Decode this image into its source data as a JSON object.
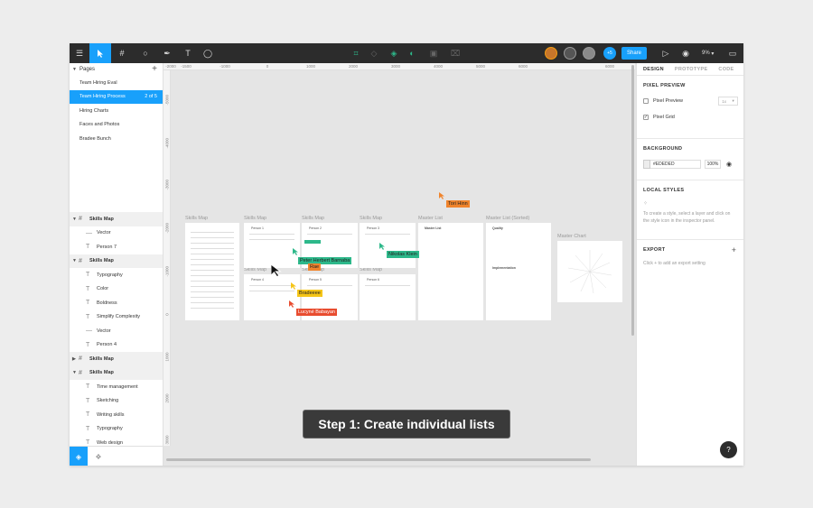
{
  "toolbar": {
    "share_label": "Share",
    "zoom_label": "9%",
    "avatar_count": "+5"
  },
  "pages": {
    "header": "Pages",
    "items": [
      {
        "label": "Team Hiring Eval"
      },
      {
        "label": "Team Hiring Process",
        "badge": "2 of 5"
      },
      {
        "label": "Hiring Charts"
      },
      {
        "label": "Faces and Photos"
      },
      {
        "label": "Bradee Bunch"
      }
    ]
  },
  "layers": [
    {
      "label": "Skills Map",
      "type": "frame"
    },
    {
      "label": "Vector",
      "type": "vector"
    },
    {
      "label": "Person 7",
      "type": "text"
    },
    {
      "label": "Skills Map",
      "type": "frame"
    },
    {
      "label": "Typography",
      "type": "text"
    },
    {
      "label": "Color",
      "type": "text"
    },
    {
      "label": "Boldness",
      "type": "text"
    },
    {
      "label": "Simplify Complexity",
      "type": "text"
    },
    {
      "label": "Vector",
      "type": "vector"
    },
    {
      "label": "Person 4",
      "type": "text"
    },
    {
      "label": "Skills Map",
      "type": "frame"
    },
    {
      "label": "Skills Map",
      "type": "frame"
    },
    {
      "label": "Time management",
      "type": "text"
    },
    {
      "label": "Sketching",
      "type": "text"
    },
    {
      "label": "Writing skills",
      "type": "text"
    },
    {
      "label": "Typography",
      "type": "text"
    },
    {
      "label": "Web design",
      "type": "text"
    }
  ],
  "ruler": {
    "top": [
      "-2000",
      "-1500",
      "-1000",
      "0",
      "1000",
      "2000",
      "3000",
      "4000",
      "5000",
      "6000",
      "6000"
    ],
    "left": [
      "-5000",
      "-4000",
      "-3000",
      "-2000",
      "-1000",
      "0",
      "1000",
      "2000",
      "3000"
    ]
  },
  "canvas": {
    "frames": [
      {
        "label": "Skills Map"
      },
      {
        "label": "Skills Map"
      },
      {
        "label": "Skills Map"
      },
      {
        "label": "Skills Map"
      },
      {
        "label": "Master List"
      },
      {
        "label": "Master List (Sorted)"
      },
      {
        "label": "Master Chart"
      },
      {
        "label": "Skills Map"
      },
      {
        "label": "Skills Map"
      },
      {
        "label": "Skills Map"
      }
    ],
    "artboard_text": {
      "person1": "Person 1",
      "person2": "Person 2",
      "person3": "Person 3",
      "person4": "Person 4",
      "person5": "Person 5",
      "person6": "Person 6",
      "master": "Master List",
      "sorted1": "Quality",
      "sorted2": "Implementation"
    },
    "cursors": [
      {
        "name": "Tori Hinn",
        "color": "#f0842c"
      },
      {
        "name": "Peter Herbert Barnaba",
        "color": "#2db88a"
      },
      {
        "name": "Rae",
        "color": "#f0842c"
      },
      {
        "name": "Nikolas Klein",
        "color": "#2db88a"
      },
      {
        "name": "Bradeeee",
        "color": "#f5c518"
      },
      {
        "name": "Lucyné Babayan",
        "color": "#e84c2f"
      }
    ]
  },
  "banner": "Step 1: Create individual lists",
  "right_panel": {
    "tabs": [
      "DESIGN",
      "PROTOTYPE",
      "CODE"
    ],
    "pixel_preview": {
      "title": "PIXEL PREVIEW",
      "pixel_preview_label": "Pixel Preview",
      "pixel_grid_label": "Pixel Grid",
      "scale": "1x"
    },
    "background": {
      "title": "BACKGROUND",
      "hex": "#EDEDED",
      "opacity": "100%"
    },
    "local_styles": {
      "title": "LOCAL STYLES",
      "hint": "To create a style, select a layer and click on the style icon in the inspector panel."
    },
    "export": {
      "title": "EXPORT",
      "hint": "Click + to add an export setting"
    }
  },
  "help_label": "?",
  "colors": {
    "accent": "#18a0fb",
    "toolbar_bg": "#2c2c2c",
    "canvas_bg": "#e5e5e5"
  }
}
